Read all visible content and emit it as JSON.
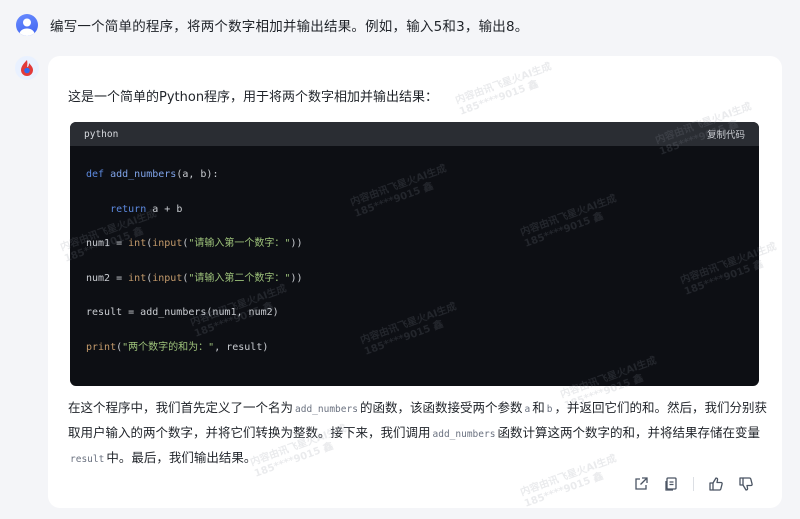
{
  "user": {
    "question": "编写一个简单的程序，将两个数字相加并输出结果。例如，输入5和3，输出8。"
  },
  "answer": {
    "intro": "这是一个简单的Python程序，用于将两个数字相加并输出结果：",
    "code": {
      "language": "python",
      "copy_label": "复制代码",
      "lines": [
        [
          "def",
          " ",
          "add_numbers",
          "(a, b):"
        ],
        [
          "    ",
          "return",
          " a + b",
          ""
        ],
        [
          "num1 = ",
          "int",
          "(",
          "input",
          "(",
          "\"请输入第一个数字：\"",
          "))"
        ],
        [
          "num2 = ",
          "int",
          "(",
          "input",
          "(",
          "\"请输入第二个数字：\"",
          "))"
        ],
        [
          "result = add_numbers(num1, num2)"
        ],
        [
          "print",
          "(",
          "\"两个数字的和为：\"",
          ", result)"
        ]
      ]
    },
    "explain": {
      "p1": "在这个程序中，我们首先定义了一个名为",
      "code1": "add_numbers",
      "p2": "的函数，该函数接受两个参数",
      "code2": "a",
      "p3": "和",
      "code3": "b",
      "p4": "，并返回它们的和。然后，我们分别获取用户输入的两个数字，并将它们转换为整数。接下来，我们调用",
      "code4": "add_numbers",
      "p5": "函数计算这两个数字的和，并将结果存储在变量",
      "code5": "result",
      "p6": "中。最后，我们输出结果。"
    }
  },
  "watermark": {
    "line1": "内容由讯飞星火AI生成",
    "line2": "185****9015 鑫"
  },
  "icons": {
    "share": "share-icon",
    "copy": "copy-icon",
    "like": "thumbs-up-icon",
    "dislike": "thumbs-down-icon"
  }
}
